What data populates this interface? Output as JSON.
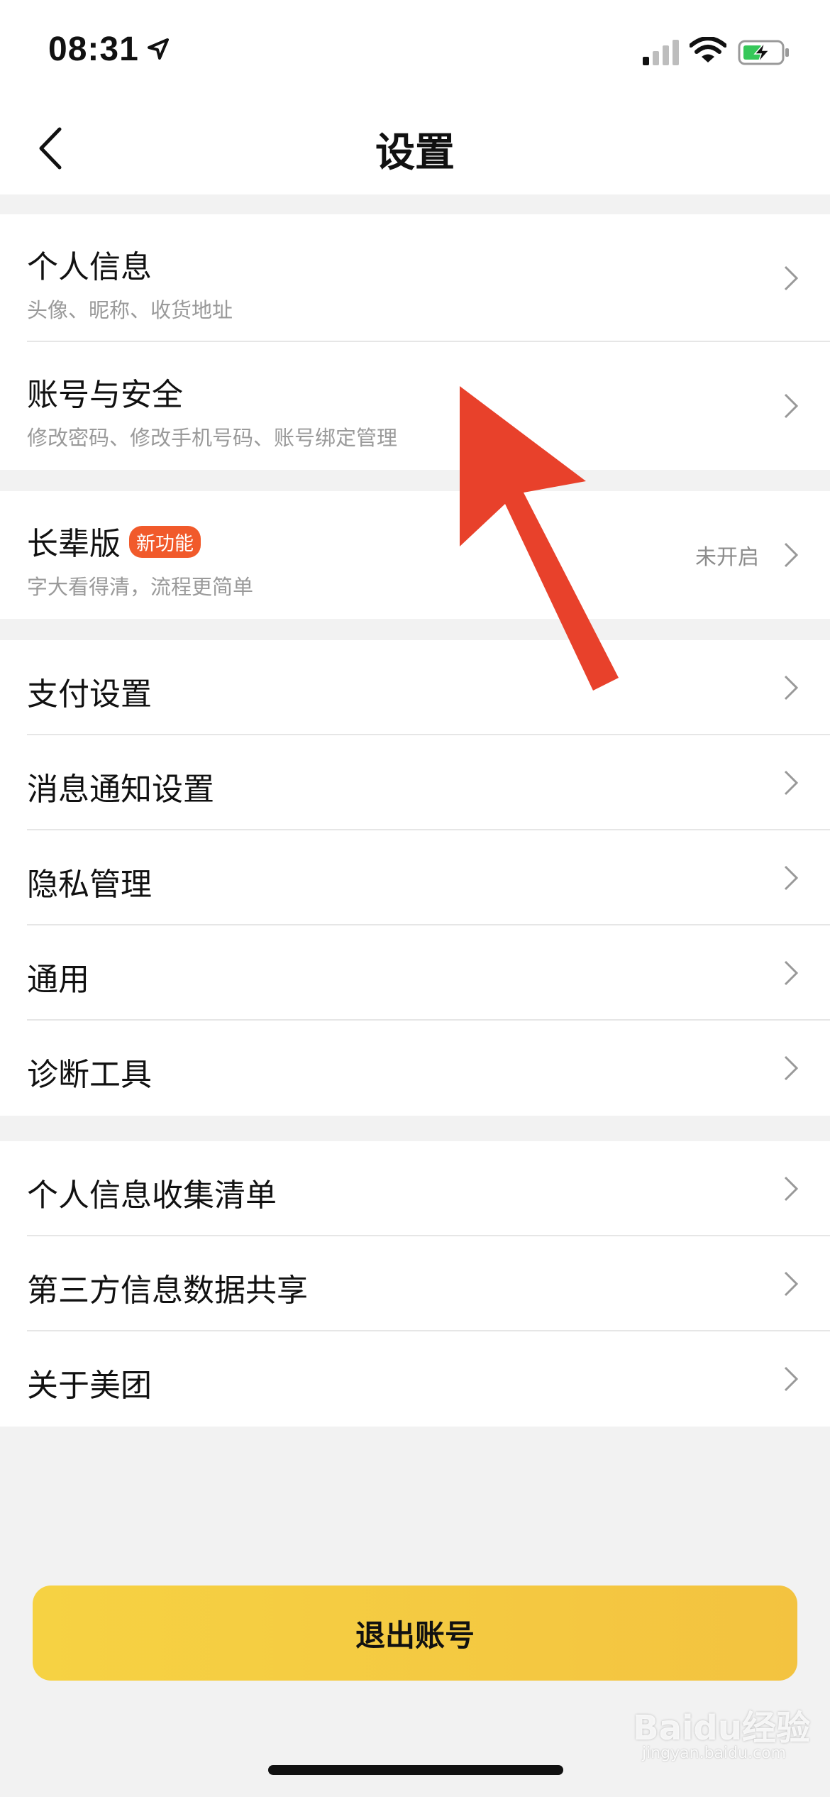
{
  "status_bar": {
    "time": "08:31"
  },
  "nav": {
    "title": "设置"
  },
  "groups": {
    "account": [
      {
        "title": "个人信息",
        "subtitle": "头像、昵称、收货地址"
      },
      {
        "title": "账号与安全",
        "subtitle": "修改密码、修改手机号码、账号绑定管理"
      }
    ],
    "elder": {
      "title": "长辈版",
      "badge": "新功能",
      "subtitle": "字大看得清，流程更简单",
      "status": "未开启"
    },
    "settings": [
      {
        "title": "支付设置"
      },
      {
        "title": "消息通知设置"
      },
      {
        "title": "隐私管理"
      },
      {
        "title": "通用"
      },
      {
        "title": "诊断工具"
      }
    ],
    "info": [
      {
        "title": "个人信息收集清单"
      },
      {
        "title": "第三方信息数据共享"
      },
      {
        "title": "关于美团"
      }
    ]
  },
  "logout_label": "退出账号",
  "watermark": {
    "brand": "Baidu经验",
    "url": "jingyan.baidu.com"
  },
  "colors": {
    "accent": "#f5cb42",
    "badge": "#f15a2b",
    "arrow": "#e8412b"
  }
}
